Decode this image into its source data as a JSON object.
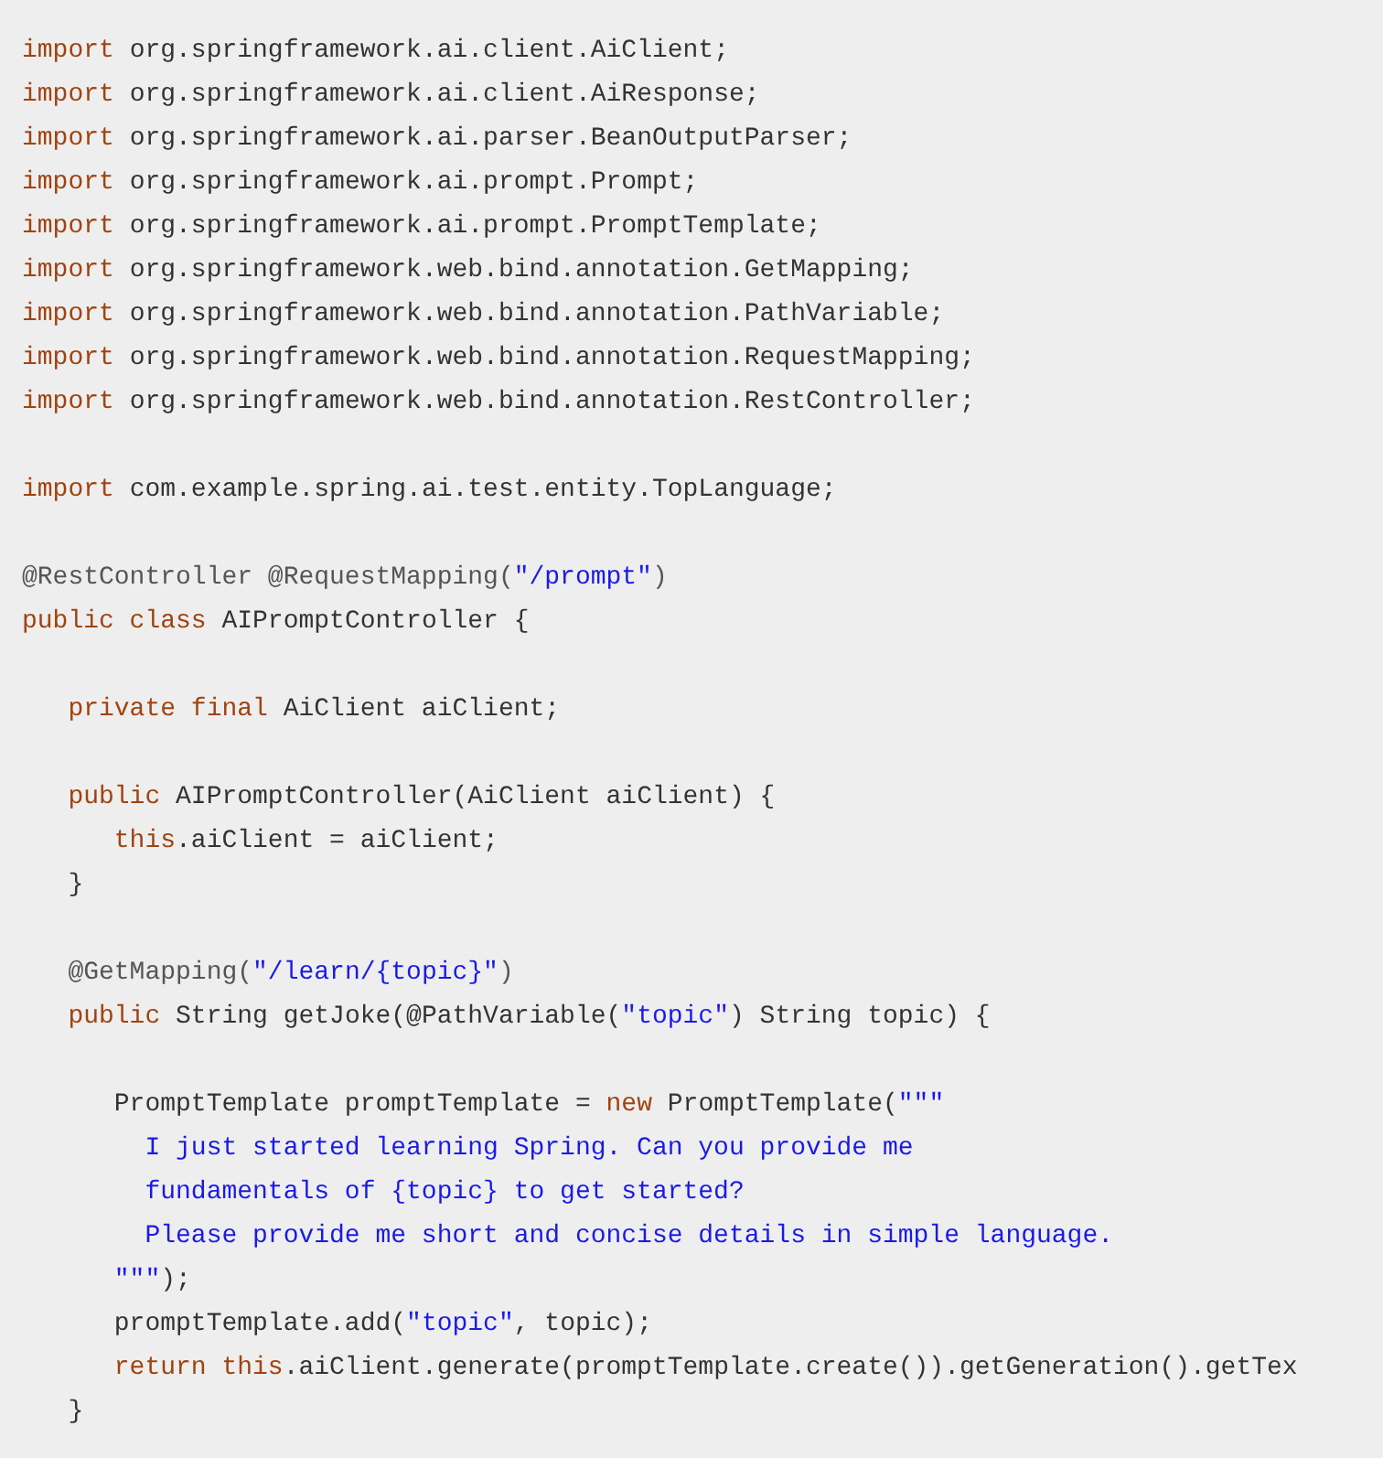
{
  "code_lines": [
    {
      "kind": "code",
      "tokens": [
        {
          "kind": "keyword",
          "text": "import"
        },
        {
          "kind": "plain",
          "text": " org.springframework.ai.client.AiClient;"
        }
      ]
    },
    {
      "kind": "code",
      "tokens": [
        {
          "kind": "keyword",
          "text": "import"
        },
        {
          "kind": "plain",
          "text": " org.springframework.ai.client.AiResponse;"
        }
      ]
    },
    {
      "kind": "code",
      "tokens": [
        {
          "kind": "keyword",
          "text": "import"
        },
        {
          "kind": "plain",
          "text": " org.springframework.ai.parser.BeanOutputParser;"
        }
      ]
    },
    {
      "kind": "code",
      "tokens": [
        {
          "kind": "keyword",
          "text": "import"
        },
        {
          "kind": "plain",
          "text": " org.springframework.ai.prompt.Prompt;"
        }
      ]
    },
    {
      "kind": "code",
      "tokens": [
        {
          "kind": "keyword",
          "text": "import"
        },
        {
          "kind": "plain",
          "text": " org.springframework.ai.prompt.PromptTemplate;"
        }
      ]
    },
    {
      "kind": "code",
      "tokens": [
        {
          "kind": "keyword",
          "text": "import"
        },
        {
          "kind": "plain",
          "text": " org.springframework.web.bind.annotation.GetMapping;"
        }
      ]
    },
    {
      "kind": "code",
      "tokens": [
        {
          "kind": "keyword",
          "text": "import"
        },
        {
          "kind": "plain",
          "text": " org.springframework.web.bind.annotation.PathVariable;"
        }
      ]
    },
    {
      "kind": "code",
      "tokens": [
        {
          "kind": "keyword",
          "text": "import"
        },
        {
          "kind": "plain",
          "text": " org.springframework.web.bind.annotation.RequestMapping;"
        }
      ]
    },
    {
      "kind": "code",
      "tokens": [
        {
          "kind": "keyword",
          "text": "import"
        },
        {
          "kind": "plain",
          "text": " org.springframework.web.bind.annotation.RestController;"
        }
      ]
    },
    {
      "kind": "blank"
    },
    {
      "kind": "code",
      "tokens": [
        {
          "kind": "keyword",
          "text": "import"
        },
        {
          "kind": "plain",
          "text": " com.example.spring.ai.test.entity.TopLanguage;"
        }
      ]
    },
    {
      "kind": "blank"
    },
    {
      "kind": "code",
      "tokens": [
        {
          "kind": "annotation",
          "text": "@RestController @RequestMapping("
        },
        {
          "kind": "string",
          "text": "\"/prompt\""
        },
        {
          "kind": "annotation",
          "text": ")"
        }
      ]
    },
    {
      "kind": "code",
      "tokens": [
        {
          "kind": "keyword",
          "text": "public class"
        },
        {
          "kind": "plain",
          "text": " AIPromptController {"
        }
      ]
    },
    {
      "kind": "blank"
    },
    {
      "kind": "code",
      "tokens": [
        {
          "kind": "keyword",
          "text": "   private final"
        },
        {
          "kind": "plain",
          "text": " AiClient aiClient;"
        }
      ]
    },
    {
      "kind": "blank"
    },
    {
      "kind": "code",
      "tokens": [
        {
          "kind": "keyword",
          "text": "   public"
        },
        {
          "kind": "plain",
          "text": " AIPromptController(AiClient aiClient) {"
        }
      ]
    },
    {
      "kind": "code",
      "tokens": [
        {
          "kind": "keyword",
          "text": "      this"
        },
        {
          "kind": "plain",
          "text": ".aiClient = aiClient;"
        }
      ]
    },
    {
      "kind": "code",
      "tokens": [
        {
          "kind": "plain",
          "text": "   }"
        }
      ]
    },
    {
      "kind": "blank"
    },
    {
      "kind": "code",
      "tokens": [
        {
          "kind": "annotation",
          "text": "   @GetMapping("
        },
        {
          "kind": "string",
          "text": "\"/learn/{topic}\""
        },
        {
          "kind": "annotation",
          "text": ")"
        }
      ]
    },
    {
      "kind": "code",
      "tokens": [
        {
          "kind": "keyword",
          "text": "   public"
        },
        {
          "kind": "plain",
          "text": " String getJoke(@PathVariable("
        },
        {
          "kind": "string",
          "text": "\"topic\""
        },
        {
          "kind": "plain",
          "text": ") String topic) {"
        }
      ]
    },
    {
      "kind": "blank"
    },
    {
      "kind": "code",
      "tokens": [
        {
          "kind": "plain",
          "text": "      PromptTemplate promptTemplate = "
        },
        {
          "kind": "keyword",
          "text": "new"
        },
        {
          "kind": "plain",
          "text": " PromptTemplate("
        },
        {
          "kind": "string",
          "text": "\"\"\""
        }
      ]
    },
    {
      "kind": "code",
      "tokens": [
        {
          "kind": "string",
          "text": "        I just started learning Spring. Can you provide me"
        }
      ]
    },
    {
      "kind": "code",
      "tokens": [
        {
          "kind": "string",
          "text": "        fundamentals of {topic} to get started?"
        }
      ]
    },
    {
      "kind": "code",
      "tokens": [
        {
          "kind": "string",
          "text": "        Please provide me short and concise details in simple language."
        }
      ]
    },
    {
      "kind": "code",
      "tokens": [
        {
          "kind": "string",
          "text": "      \"\"\""
        },
        {
          "kind": "plain",
          "text": ");"
        }
      ]
    },
    {
      "kind": "code",
      "tokens": [
        {
          "kind": "plain",
          "text": "      promptTemplate.add("
        },
        {
          "kind": "string",
          "text": "\"topic\""
        },
        {
          "kind": "plain",
          "text": ", topic);"
        }
      ]
    },
    {
      "kind": "code",
      "tokens": [
        {
          "kind": "keyword",
          "text": "      return this"
        },
        {
          "kind": "plain",
          "text": ".aiClient.generate(promptTemplate.create()).getGeneration().getTex"
        }
      ]
    },
    {
      "kind": "code",
      "tokens": [
        {
          "kind": "plain",
          "text": "   }"
        }
      ]
    }
  ]
}
